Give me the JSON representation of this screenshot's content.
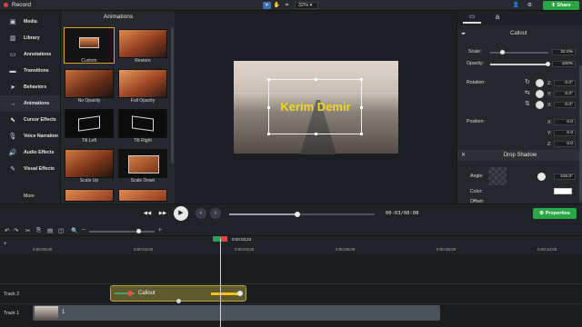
{
  "app": {
    "title": "Record",
    "zoom": "32%",
    "share_label": "Share"
  },
  "nav": {
    "items": [
      {
        "label": "Media",
        "icon": "media-icon"
      },
      {
        "label": "Library",
        "icon": "library-icon"
      },
      {
        "label": "Annotations",
        "icon": "annotations-icon"
      },
      {
        "label": "Transitions",
        "icon": "transitions-icon"
      },
      {
        "label": "Behaviors",
        "icon": "behaviors-icon"
      },
      {
        "label": "Animations",
        "icon": "animations-icon"
      },
      {
        "label": "Cursor Effects",
        "icon": "cursor-icon"
      },
      {
        "label": "Voice Narration",
        "icon": "mic-icon"
      },
      {
        "label": "Audio Effects",
        "icon": "audio-icon"
      },
      {
        "label": "Visual Effects",
        "icon": "visual-effects-icon"
      }
    ],
    "more_label": "More"
  },
  "animations": {
    "title": "Animations",
    "items": [
      {
        "label": "Custom",
        "selected": true
      },
      {
        "label": "Restore"
      },
      {
        "label": "No Opacity"
      },
      {
        "label": "Full Opacity"
      },
      {
        "label": "Tilt Left"
      },
      {
        "label": "Tilt Right"
      },
      {
        "label": "Scale Up"
      },
      {
        "label": "Scale Down"
      }
    ]
  },
  "canvas": {
    "callout_text": "Kerim Demir"
  },
  "properties": {
    "header": "Callout",
    "scale_label": "Scale:",
    "scale_value": "32.0%",
    "opacity_label": "Opacity:",
    "opacity_value": "100%",
    "rotation_label": "Rotation:",
    "position_label": "Position:",
    "rot_z": "0.0°",
    "rot_y": "0.0°",
    "rot_x": "0.0°",
    "pos_x": "0.0",
    "pos_y": "0.0",
    "pos_z": "0.0",
    "axis_x": "X:",
    "axis_y": "Y:",
    "axis_z": "Z:",
    "drop_shadow_title": "Drop Shadow",
    "angle_label": "Angle:",
    "angle_value": "315.0°",
    "color_label": "Color:",
    "offset_label": "Offset:"
  },
  "player": {
    "timecode": "00:03/00:08",
    "properties_label": "Properties"
  },
  "timeline": {
    "playhead_time": "0:00:03;23",
    "ticks": [
      "0:00:00;00",
      "0:00:02;00",
      "0:00:04;00",
      "0:00:06;00",
      "0:00:08;00",
      "0:00:10;00",
      "0:00:12;00"
    ],
    "tracks": [
      {
        "label": "Track 2",
        "clip_label": "Callout"
      },
      {
        "label": "Track 1",
        "clip_label": "1"
      }
    ]
  },
  "colors": {
    "accent_green": "#29a745",
    "selection_gold": "#d9a520",
    "callout_yellow": "#f1d81d"
  }
}
